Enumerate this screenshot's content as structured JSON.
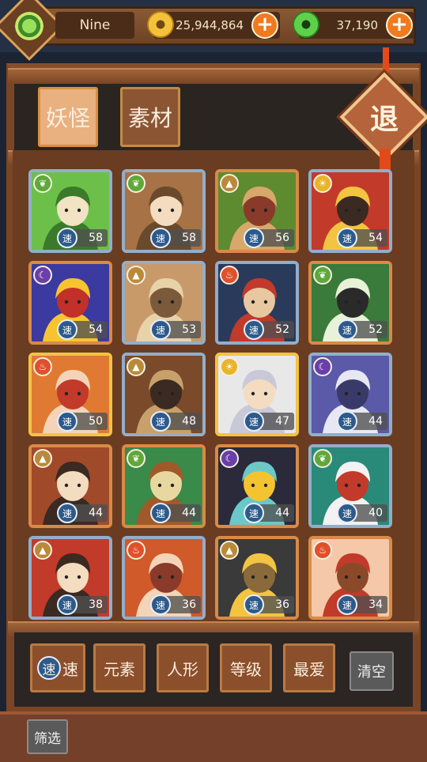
{
  "player": {
    "name": "Nine"
  },
  "currency": {
    "gold": "25,944,864",
    "jade": "37,190"
  },
  "tabs": [
    {
      "label": "妖怪",
      "active": true
    },
    {
      "label": "素材",
      "active": false
    }
  ],
  "exit_label": "退",
  "speed_char": "速",
  "cards": [
    {
      "element": "leaf",
      "speed": "58",
      "rarity": "blue",
      "art": [
        "#6cc04a",
        "#3b7a2a",
        "#f2e3c4"
      ]
    },
    {
      "element": "leaf",
      "speed": "58",
      "rarity": "blue",
      "art": [
        "#a77245",
        "#6a4a2c",
        "#f4dcc0"
      ]
    },
    {
      "element": "earth",
      "speed": "56",
      "rarity": "orange",
      "art": [
        "#5e8a30",
        "#d7a86a",
        "#8a3a2a"
      ]
    },
    {
      "element": "sun",
      "speed": "54",
      "rarity": "blue",
      "art": [
        "#c23a2a",
        "#f2c442",
        "#3a2a22"
      ]
    },
    {
      "element": "moon",
      "speed": "54",
      "rarity": "orange",
      "art": [
        "#3a3aa0",
        "#f7c430",
        "#c2302a"
      ]
    },
    {
      "element": "earth",
      "speed": "53",
      "rarity": "blue",
      "art": [
        "#c89a6a",
        "#e8d2a8",
        "#7a5a3a"
      ]
    },
    {
      "element": "fire",
      "speed": "52",
      "rarity": "blue",
      "art": [
        "#2a3a5a",
        "#c23a2a",
        "#e8c8a0"
      ]
    },
    {
      "element": "leaf",
      "speed": "52",
      "rarity": "orange",
      "art": [
        "#3a7a3a",
        "#e8f2d8",
        "#2a2a2a"
      ]
    },
    {
      "element": "fire",
      "speed": "50",
      "rarity": "gold",
      "art": [
        "#e07a32",
        "#f4d4b8",
        "#c23a2a"
      ]
    },
    {
      "element": "earth",
      "speed": "48",
      "rarity": "blue",
      "art": [
        "#7a4a2a",
        "#c8a06a",
        "#3a2a22"
      ]
    },
    {
      "element": "sun",
      "speed": "47",
      "rarity": "gold",
      "art": [
        "#e8e8e8",
        "#c8c8d8",
        "#f4dcc0"
      ]
    },
    {
      "element": "moon",
      "speed": "44",
      "rarity": "blue",
      "art": [
        "#5a5aa8",
        "#e8e8f4",
        "#3a3a6a"
      ]
    },
    {
      "element": "earth",
      "speed": "44",
      "rarity": "orange",
      "art": [
        "#a04a2a",
        "#3a2a22",
        "#f4dcc0"
      ]
    },
    {
      "element": "leaf",
      "speed": "44",
      "rarity": "orange",
      "art": [
        "#3a8a4a",
        "#a05a2a",
        "#e8d8a0"
      ]
    },
    {
      "element": "moon",
      "speed": "44",
      "rarity": "orange",
      "art": [
        "#2a2a3a",
        "#6ac8c8",
        "#f4c430"
      ]
    },
    {
      "element": "leaf",
      "speed": "40",
      "rarity": "blue",
      "art": [
        "#2a8a7a",
        "#f2f2f2",
        "#c23a2a"
      ]
    },
    {
      "element": "earth",
      "speed": "38",
      "rarity": "blue",
      "art": [
        "#c23a2a",
        "#3a2a22",
        "#f4dcc0"
      ]
    },
    {
      "element": "fire",
      "speed": "36",
      "rarity": "blue",
      "art": [
        "#d05a2a",
        "#f4d4b8",
        "#8a3a2a"
      ]
    },
    {
      "element": "earth",
      "speed": "36",
      "rarity": "orange",
      "art": [
        "#3a3a3a",
        "#f2c442",
        "#8a6a3a"
      ]
    },
    {
      "element": "fire",
      "speed": "34",
      "rarity": "orange",
      "art": [
        "#f4c8a8",
        "#c23a2a",
        "#8a4a2a"
      ]
    }
  ],
  "filters": [
    "速",
    "元素",
    "人形",
    "等级",
    "最爱"
  ],
  "clear_label": "清空",
  "screen_label": "筛选"
}
